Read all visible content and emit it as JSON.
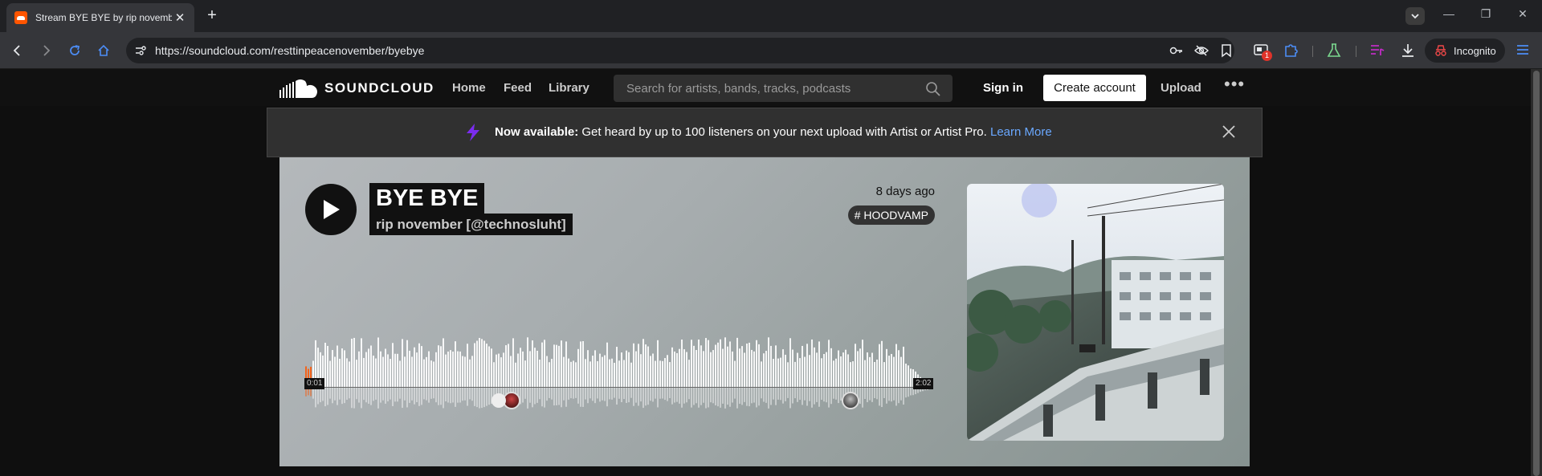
{
  "browser": {
    "tab_title": "Stream BYE BYE by rip november",
    "url": "https://soundcloud.com/resttinpeacenovember/byebye",
    "incognito_label": "Incognito",
    "extension_badge": "1"
  },
  "header": {
    "logo_text": "SOUNDCLOUD",
    "nav": [
      "Home",
      "Feed",
      "Library"
    ],
    "search_placeholder": "Search for artists, bands, tracks, podcasts",
    "sign_in": "Sign in",
    "create_account": "Create account",
    "upload": "Upload"
  },
  "banner": {
    "bold": "Now available:",
    "text": " Get heard by up to 100 listeners on your next upload with Artist or Artist Pro. ",
    "link": "Learn More"
  },
  "track": {
    "title": "BYE BYE",
    "artist": "rip november [@technosluht]",
    "posted": "8 days ago",
    "tag": "# HOODVAMP",
    "current_time": "0:01",
    "duration": "2:02",
    "progress_fraction": 0.008
  },
  "colors": {
    "accent": "#ff5500",
    "link": "#6aa8ff"
  }
}
